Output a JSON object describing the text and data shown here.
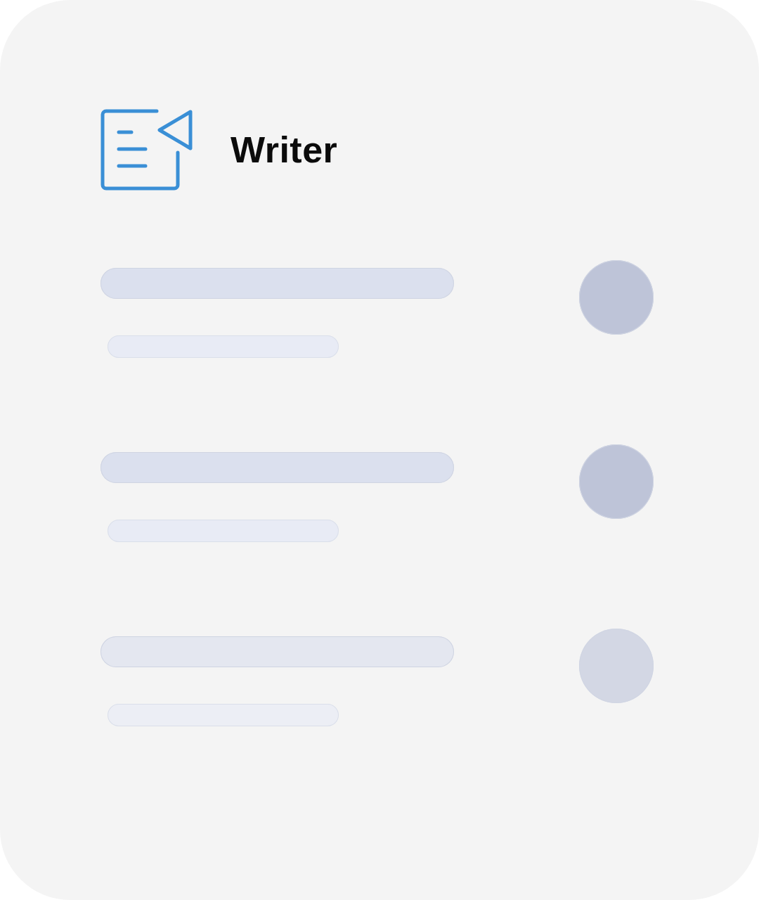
{
  "header": {
    "title": "Writer"
  },
  "rows": [
    {
      "kind": "skeleton"
    },
    {
      "kind": "skeleton"
    },
    {
      "kind": "skeleton"
    }
  ]
}
